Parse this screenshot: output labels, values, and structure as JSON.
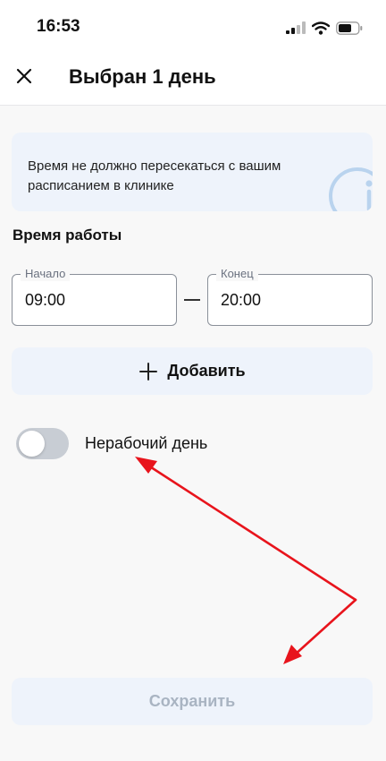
{
  "status_bar": {
    "time": "16:53",
    "icons": [
      "signal-icon",
      "wifi-icon",
      "battery-icon"
    ]
  },
  "header": {
    "close_icon": "close-icon",
    "title": "Выбран 1 день"
  },
  "info_card": {
    "text": "Время не должно пересекаться с вашим расписанием в клинике",
    "icon": "info-icon"
  },
  "work_time": {
    "section_title": "Время работы",
    "start": {
      "label": "Начало",
      "value": "09:00"
    },
    "end": {
      "label": "Конец",
      "value": "20:00"
    },
    "add_label": "Добавить",
    "add_icon": "plus-icon"
  },
  "day_off": {
    "label": "Нерабочий день",
    "enabled": false
  },
  "footer": {
    "save_label": "Сохранить",
    "save_enabled": false
  },
  "annotation_color": "#e8141c",
  "colors": {
    "accent_light": "#eef3fb",
    "disabled_text": "#a9b4c2",
    "toggle_off": "#c8cdd4"
  }
}
